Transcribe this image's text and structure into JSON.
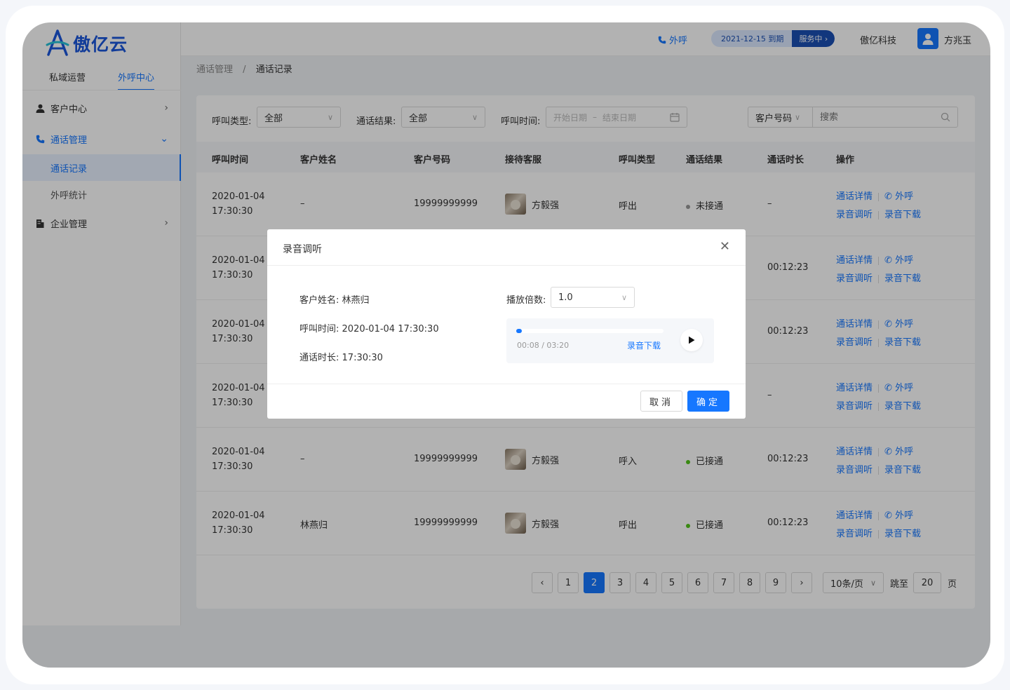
{
  "brand": {
    "name": "傲亿云",
    "color": "#1a56db"
  },
  "top_tabs": [
    "私域运营",
    "外呼中心"
  ],
  "menu": {
    "customer_center": "客户中心",
    "call_management": "通话管理",
    "call_records": "通话记录",
    "outbound_stats": "外呼统计",
    "enterprise": "企业管理"
  },
  "header": {
    "call_label": "外呼",
    "expire_text": "2021-12-15  到期",
    "service_status": "服务中",
    "company": "傲亿科技",
    "user": "方兆玉"
  },
  "breadcrumb": {
    "parent": "通话管理",
    "sep": "/",
    "current": "通话记录"
  },
  "filters": {
    "call_type_label": "呼叫类型:",
    "call_type_value": "全部",
    "result_label": "通话结果:",
    "result_value": "全部",
    "time_label": "呼叫时间:",
    "date_start": "开始日期",
    "date_sep": "–",
    "date_end": "结束日期",
    "search_type": "客户号码",
    "search_placeholder": "搜索"
  },
  "table": {
    "columns": [
      "呼叫时间",
      "客户姓名",
      "客户号码",
      "接待客服",
      "呼叫类型",
      "通话结果",
      "通话时长",
      "操作"
    ],
    "ops": {
      "detail": "通话详情",
      "call": "外呼",
      "listen": "录音调听",
      "download": "录音下载"
    },
    "rows": [
      {
        "date": "2020-01-04",
        "time": "17:30:30",
        "name": "–",
        "phone": "19999999999",
        "agent": "方毅强",
        "type": "呼出",
        "result": "未接通",
        "result_color": "#999999",
        "duration": "–"
      },
      {
        "date": "2020-01-04",
        "time": "17:30:30",
        "name": "",
        "phone": "",
        "agent": "",
        "type": "",
        "result": "",
        "result_color": "",
        "duration": "00:12:23"
      },
      {
        "date": "2020-01-04",
        "time": "17:30:30",
        "name": "",
        "phone": "",
        "agent": "",
        "type": "",
        "result": "",
        "result_color": "",
        "duration": "00:12:23"
      },
      {
        "date": "2020-01-04",
        "time": "17:30:30",
        "name": "",
        "phone": "",
        "agent": "",
        "type": "",
        "result": "",
        "result_color": "",
        "duration": "–"
      },
      {
        "date": "2020-01-04",
        "time": "17:30:30",
        "name": "–",
        "phone": "19999999999",
        "agent": "方毅强",
        "type": "呼入",
        "result": "已接通",
        "result_color": "#52c41a",
        "duration": "00:12:23"
      },
      {
        "date": "2020-01-04",
        "time": "17:30:30",
        "name": "林燕归",
        "phone": "19999999999",
        "agent": "方毅强",
        "type": "呼出",
        "result": "已接通",
        "result_color": "#52c41a",
        "duration": "00:12:23"
      }
    ]
  },
  "pagination": {
    "pages": [
      "1",
      "2",
      "3",
      "4",
      "5",
      "6",
      "7",
      "8",
      "9"
    ],
    "current": "2",
    "page_size": "10条/页",
    "jump_label": "跳至",
    "jump_value": "20",
    "page_unit": "页"
  },
  "modal": {
    "title": "录音调听",
    "customer_label": "客户姓名:",
    "customer_value": "林燕归",
    "call_time_label": "呼叫时间:",
    "call_time_value": "2020-01-04  17:30:30",
    "duration_label": "通话时长:",
    "duration_value": "17:30:30",
    "speed_label": "播放倍数:",
    "speed_value": "1.0",
    "player_time": "00:08 / 03:20",
    "player_progress": 0.04,
    "download_label": "录音下载",
    "cancel_label": "取消",
    "ok_label": "确定"
  },
  "colors": {
    "primary": "#1677ff",
    "connected": "#52c41a",
    "missed": "#999999"
  }
}
